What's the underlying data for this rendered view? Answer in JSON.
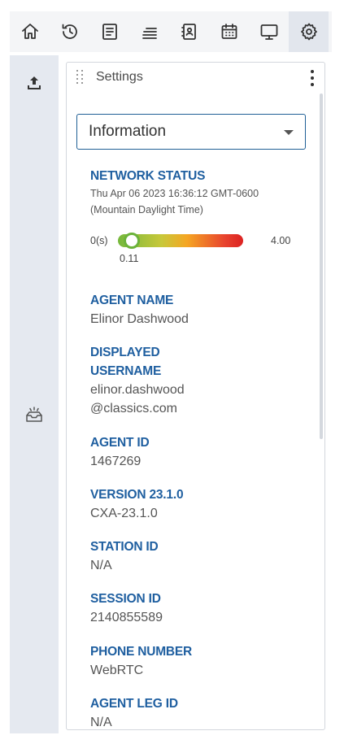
{
  "nav": {
    "items": [
      {
        "icon": "home-icon",
        "label": "Home"
      },
      {
        "icon": "history-icon",
        "label": "History"
      },
      {
        "icon": "notes-icon",
        "label": "Notes"
      },
      {
        "icon": "queue-icon",
        "label": "Queue"
      },
      {
        "icon": "contacts-icon",
        "label": "Contacts"
      },
      {
        "icon": "calendar-icon",
        "label": "Calendar"
      },
      {
        "icon": "monitor-icon",
        "label": "Monitor"
      },
      {
        "icon": "gear-icon",
        "label": "Settings",
        "active": true
      }
    ]
  },
  "rail": {
    "items": [
      {
        "icon": "upload-icon"
      },
      {
        "icon": "inbox-icon"
      }
    ]
  },
  "panel": {
    "title": "Settings",
    "select": {
      "value": "Information"
    },
    "network_status": {
      "label": "NETWORK STATUS",
      "timestamp_line1": "Thu Apr 06 2023 16:36:12 GMT-0600",
      "timestamp_line2": "(Mountain Daylight Time)",
      "gauge": {
        "min_label": "0(s)",
        "max_label": "4.00",
        "value_label": "0.11",
        "value": 0.11,
        "max": 4.0
      }
    },
    "agent_name": {
      "label": "AGENT NAME",
      "value": "Elinor Dashwood"
    },
    "displayed_username": {
      "label_line1": "DISPLAYED",
      "label_line2": "USERNAME",
      "value_line1": "elinor.dashwood",
      "value_line2": "@classics.com"
    },
    "agent_id": {
      "label": "AGENT ID",
      "value": "1467269"
    },
    "version": {
      "label": "VERSION 23.1.0",
      "value": "CXA-23.1.0"
    },
    "station_id": {
      "label": "STATION ID",
      "value": "N/A"
    },
    "session_id": {
      "label": "SESSION ID",
      "value": "2140855589"
    },
    "phone_number": {
      "label": "PHONE NUMBER",
      "value": "WebRTC"
    },
    "agent_leg_id": {
      "label": "AGENT LEG ID",
      "value": "N/A"
    }
  },
  "colors": {
    "label": "#1f5fa0",
    "select_border": "#1f5f95",
    "rail_bg": "#e5e9f0",
    "active_tab_bg": "#e2e6ed"
  }
}
